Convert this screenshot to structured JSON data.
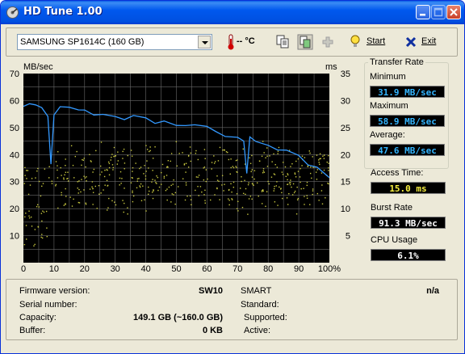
{
  "window": {
    "title": "HD Tune 1.00"
  },
  "toolbar": {
    "drive_selected": "SAMSUNG SP1614C (160 GB)",
    "temperature": "-- °C",
    "start_label": "Start",
    "exit_label": "Exit"
  },
  "chart": {
    "left_unit": "MB/sec",
    "right_unit": "ms",
    "y_left_ticks": [
      "70",
      "60",
      "50",
      "40",
      "30",
      "20",
      "10"
    ],
    "y_right_ticks": [
      "35",
      "30",
      "25",
      "20",
      "15",
      "10",
      "5"
    ],
    "x_ticks": [
      "0",
      "10",
      "20",
      "30",
      "40",
      "50",
      "60",
      "70",
      "80",
      "90",
      "100%"
    ]
  },
  "chart_data": {
    "type": "line",
    "x": [
      0,
      2,
      4,
      6,
      8,
      9,
      10,
      12,
      15,
      18,
      20,
      23,
      26,
      30,
      33,
      36,
      40,
      43,
      46,
      50,
      53,
      56,
      60,
      63,
      66,
      70,
      72,
      73,
      74,
      76,
      80,
      83,
      86,
      90,
      93,
      96,
      100
    ],
    "series": [
      {
        "values": [
          57.5,
          58.5,
          58.0,
          57.0,
          55.0,
          37.0,
          55.5,
          57.0,
          56.5,
          56.0,
          55.5,
          55.0,
          55.0,
          54.5,
          54.0,
          53.5,
          53.0,
          52.5,
          52.0,
          51.5,
          50.5,
          50.0,
          49.5,
          48.5,
          47.5,
          46.5,
          45.5,
          34.0,
          46.0,
          45.5,
          44.0,
          42.5,
          41.0,
          39.0,
          37.0,
          35.0,
          32.5
        ],
        "axis": "left",
        "color": "#3399ff"
      }
    ],
    "scatter_color": "#c8c840",
    "access_time_band_ms": [
      11,
      21
    ],
    "xlim": [
      0,
      100
    ],
    "ylim": [
      0,
      70
    ],
    "y2lim": [
      0,
      35
    ],
    "grid": true
  },
  "transfer": {
    "group_title": "Transfer Rate",
    "min_label": "Minimum",
    "min_value": "31.9 MB/sec",
    "max_label": "Maximum",
    "max_value": "58.9 MB/sec",
    "avg_label": "Average:",
    "avg_value": "47.6 MB/sec"
  },
  "access": {
    "label": "Access Time:",
    "value": "15.0 ms"
  },
  "burst": {
    "label": "Burst Rate",
    "value": "91.3 MB/sec"
  },
  "cpu": {
    "label": "CPU Usage",
    "value": "6.1%"
  },
  "info": {
    "firmware_label": "Firmware version:",
    "firmware_value": "SW10",
    "serial_label": "Serial number:",
    "serial_value": "",
    "capacity_label": "Capacity:",
    "capacity_value": "149.1 GB (~160.0 GB)",
    "buffer_label": "Buffer:",
    "buffer_value": "0 KB",
    "smart_label": "SMART",
    "smart_value": "n/a",
    "standard_label": "Standard:",
    "supported_label": "Supported:",
    "active_label": "Active:"
  },
  "colors": {
    "title_bar": "#0058ee",
    "window_bg": "#ece9d8",
    "chart_bg": "#000000",
    "transfer_line": "#3399ff",
    "access_dots": "#c8c840"
  }
}
